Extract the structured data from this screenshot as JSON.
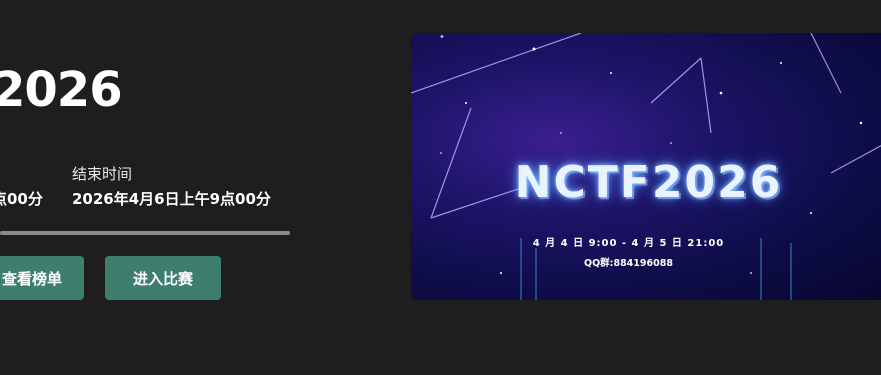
{
  "competition": {
    "title": "2026",
    "start": {
      "value": "点00分"
    },
    "end": {
      "label": "结束时间",
      "value": "2026年4月6日上午9点00分"
    },
    "progress": 1.0
  },
  "actions": {
    "leaderboard_label": "查看榜单",
    "enter_label": "进入比赛"
  },
  "banner": {
    "title": "NCTF2026",
    "date_range": "4 月 4 日 9:00 - 4 月 5 日 21:00",
    "qq_group": "QQ群:884196088"
  },
  "colors": {
    "background": "#1e1e1e",
    "button": "#3e7e6f",
    "progress_track": "#6e6e6e"
  }
}
